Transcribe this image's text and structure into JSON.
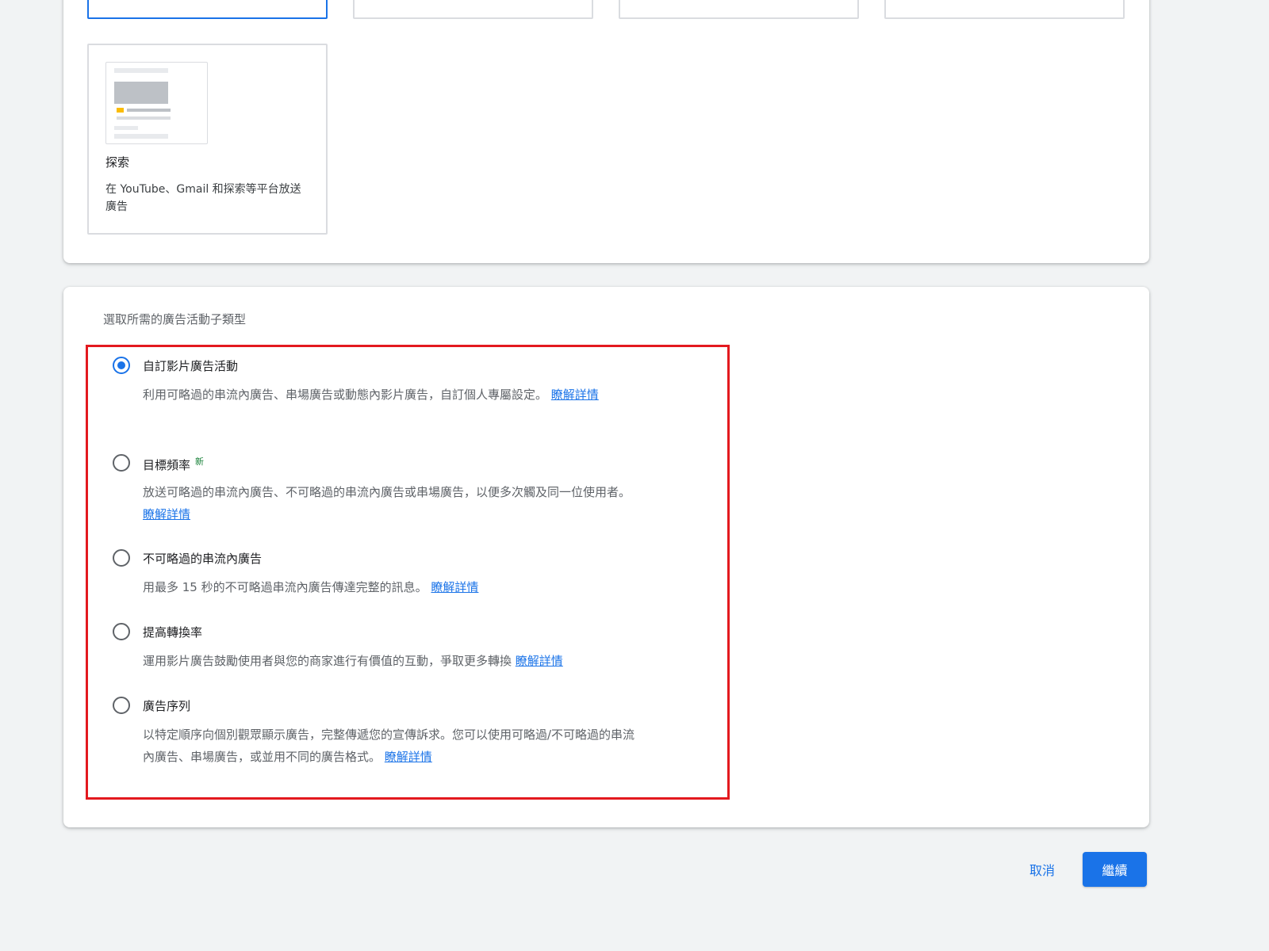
{
  "campaign_types": {
    "discovery": {
      "title": "探索",
      "description": "在 YouTube、Gmail 和探索等平台放送廣告"
    }
  },
  "subtype_section": {
    "label": "選取所需的廣告活動子類型",
    "options": [
      {
        "title": "自訂影片廣告活動",
        "description": "利用可略過的串流內廣告、串場廣告或動態內影片廣告，自訂個人專屬設定。",
        "link": "瞭解詳情",
        "selected": true
      },
      {
        "title": "目標頻率",
        "badge": "新",
        "description": "放送可略過的串流內廣告、不可略過的串流內廣告或串場廣告，以便多次觸及同一位使用者。",
        "link": "瞭解詳情",
        "selected": false
      },
      {
        "title": "不可略過的串流內廣告",
        "description": "用最多 15 秒的不可略過串流內廣告傳達完整的訊息。",
        "link": "瞭解詳情",
        "selected": false
      },
      {
        "title": "提高轉換率",
        "description": "運用影片廣告鼓勵使用者與您的商家進行有價值的互動，爭取更多轉換",
        "link": "瞭解詳情",
        "selected": false
      },
      {
        "title": "廣告序列",
        "description": "以特定順序向個別觀眾顯示廣告，完整傳遞您的宣傳訴求。您可以使用可略過/不可略過的串流內廣告、串場廣告，或並用不同的廣告格式。",
        "link": "瞭解詳情",
        "selected": false
      }
    ]
  },
  "footer": {
    "cancel_label": "取消",
    "continue_label": "繼續"
  },
  "colors": {
    "accent": "#1a73e8",
    "highlight_border": "#e3191f",
    "new_badge": "#188038"
  }
}
